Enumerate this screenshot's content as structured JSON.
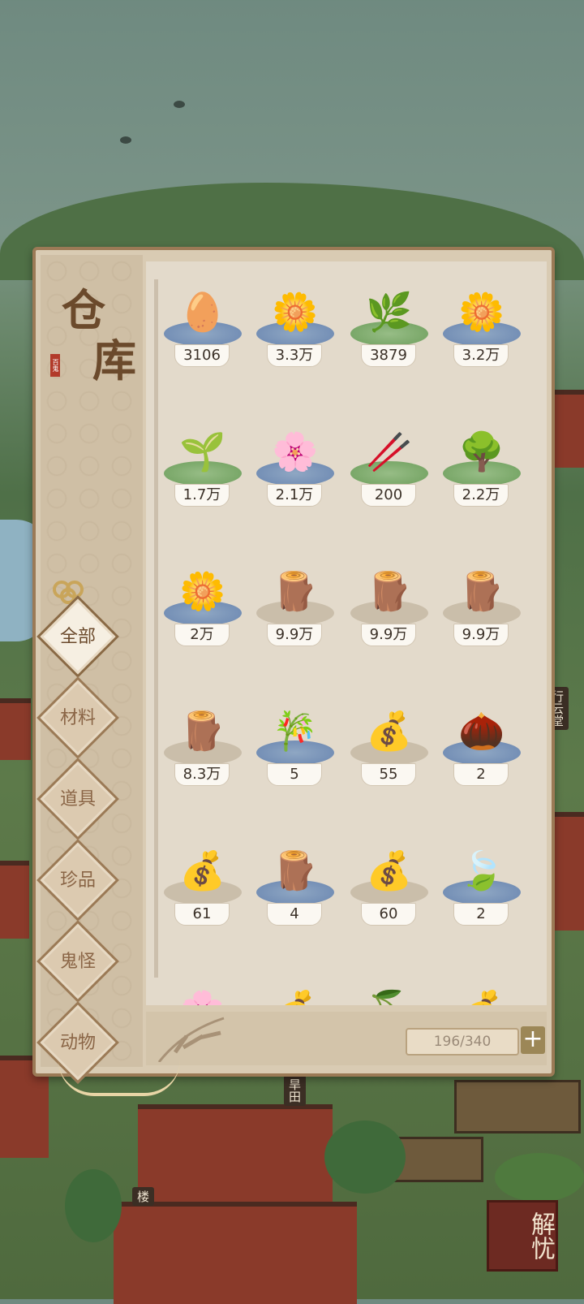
{
  "warehouse": {
    "title_top": "仓",
    "title_bottom": "库",
    "seal": "百鬼",
    "capacity": "196/340",
    "add_label": "+"
  },
  "categories": [
    {
      "label": "全部",
      "active": true
    },
    {
      "label": "材料"
    },
    {
      "label": "道具"
    },
    {
      "label": "珍品"
    },
    {
      "label": "鬼怪"
    },
    {
      "label": "动物"
    }
  ],
  "items": [
    {
      "icon": "seeds-icon",
      "glyph": "🥚",
      "base": "blue",
      "count": "3106"
    },
    {
      "icon": "white-lily-icon",
      "glyph": "🌼",
      "base": "blue",
      "count": "3.3万"
    },
    {
      "icon": "orchid-grass-icon",
      "glyph": "🌿",
      "base": "green",
      "count": "3879"
    },
    {
      "icon": "chrysanthemum-icon",
      "glyph": "🌼",
      "base": "blue",
      "count": "3.2万"
    },
    {
      "icon": "ivy-branch-icon",
      "glyph": "🌱",
      "base": "green",
      "count": "1.7万"
    },
    {
      "icon": "peony-icon",
      "glyph": "🌸",
      "base": "blue",
      "count": "2.1万"
    },
    {
      "icon": "sticks-icon",
      "glyph": "🥢",
      "base": "green",
      "count": "200"
    },
    {
      "icon": "plum-branch-icon",
      "glyph": "🌳",
      "base": "green",
      "count": "2.2万"
    },
    {
      "icon": "yellow-rose-icon",
      "glyph": "🌼",
      "base": "blue",
      "count": "2万"
    },
    {
      "icon": "log-icon",
      "glyph": "🪵",
      "base": "plain",
      "count": "9.9万"
    },
    {
      "icon": "log-icon",
      "glyph": "🪵",
      "base": "plain",
      "count": "9.9万"
    },
    {
      "icon": "log-icon",
      "glyph": "🪵",
      "base": "plain",
      "count": "9.9万"
    },
    {
      "icon": "log-icon",
      "glyph": "🪵",
      "base": "plain",
      "count": "8.3万"
    },
    {
      "icon": "bamboo-icon",
      "glyph": "🎋",
      "base": "blue",
      "count": "5"
    },
    {
      "icon": "seed-bag-icon",
      "glyph": "💰",
      "base": "plain",
      "count": "55"
    },
    {
      "icon": "bamboo-shoot-icon",
      "glyph": "🌰",
      "base": "blue",
      "count": "2"
    },
    {
      "icon": "peach-seed-bag-icon",
      "glyph": "💰",
      "base": "plain",
      "count": "61"
    },
    {
      "icon": "bark-icon",
      "glyph": "🪵",
      "base": "blue",
      "count": "4"
    },
    {
      "icon": "flower-seed-bag-icon",
      "glyph": "💰",
      "base": "plain",
      "count": "60"
    },
    {
      "icon": "tea-leaf-icon",
      "glyph": "🍃",
      "base": "blue",
      "count": "2"
    }
  ],
  "partial_items": [
    {
      "icon": "pink-flower-icon",
      "glyph": "🌸"
    },
    {
      "icon": "seed-bag-icon",
      "glyph": "💰"
    },
    {
      "icon": "red-fruit-icon",
      "glyph": "🍒"
    },
    {
      "icon": "seed-bag-icon",
      "glyph": "💰"
    }
  ],
  "scene": {
    "label_field": "旱田",
    "label_tower": "楼",
    "label_hall": "行云堂",
    "badge": "解忧"
  }
}
